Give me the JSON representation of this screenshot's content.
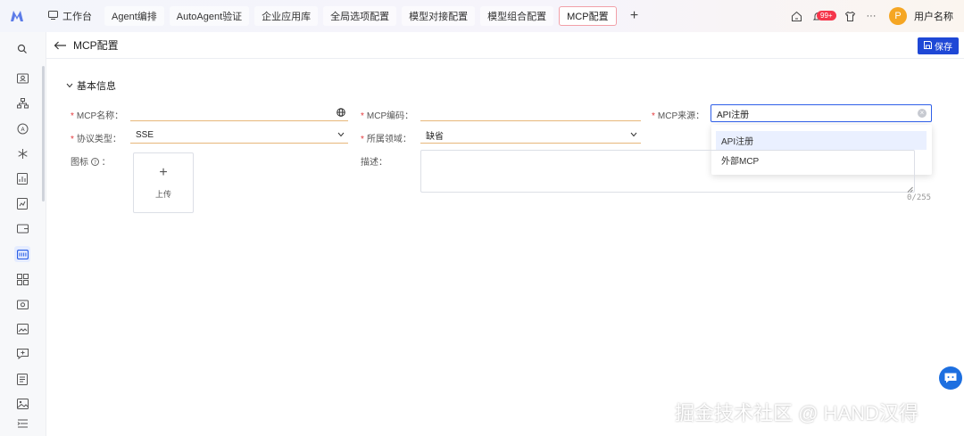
{
  "topbar": {
    "home_label": "工作台",
    "tabs": [
      "Agent编排",
      "AutoAgent验证",
      "企业应用库",
      "全局选项配置",
      "模型对接配置",
      "模型组合配置",
      "MCP配置"
    ],
    "add_label": "+",
    "badge": "99+",
    "more_label": "···",
    "avatar_letter": "P",
    "user_name": "用户名称"
  },
  "header": {
    "title": "MCP配置",
    "save_label": "保存"
  },
  "form": {
    "section_title": "基本信息",
    "name_label": "MCP名称",
    "name_value": "",
    "code_label": "MCP编码",
    "code_value": "",
    "source_label": "MCP来源",
    "source_value": "API注册",
    "source_options": [
      "API注册",
      "外部MCP"
    ],
    "protocol_label": "协议类型",
    "protocol_value": "SSE",
    "domain_label": "所属领域",
    "domain_value": "缺省",
    "icon_label": "图标",
    "upload_label": "上传",
    "desc_label": "描述",
    "desc_value": "",
    "desc_count": "0/255"
  },
  "colors": {
    "accent": "#1f48d6",
    "required": "#e4393c",
    "field_underline": "#e7b77a",
    "badge": "#f5364b",
    "avatar": "#f5a623"
  },
  "watermark": "掘金技术社区 @ HAND汉得"
}
